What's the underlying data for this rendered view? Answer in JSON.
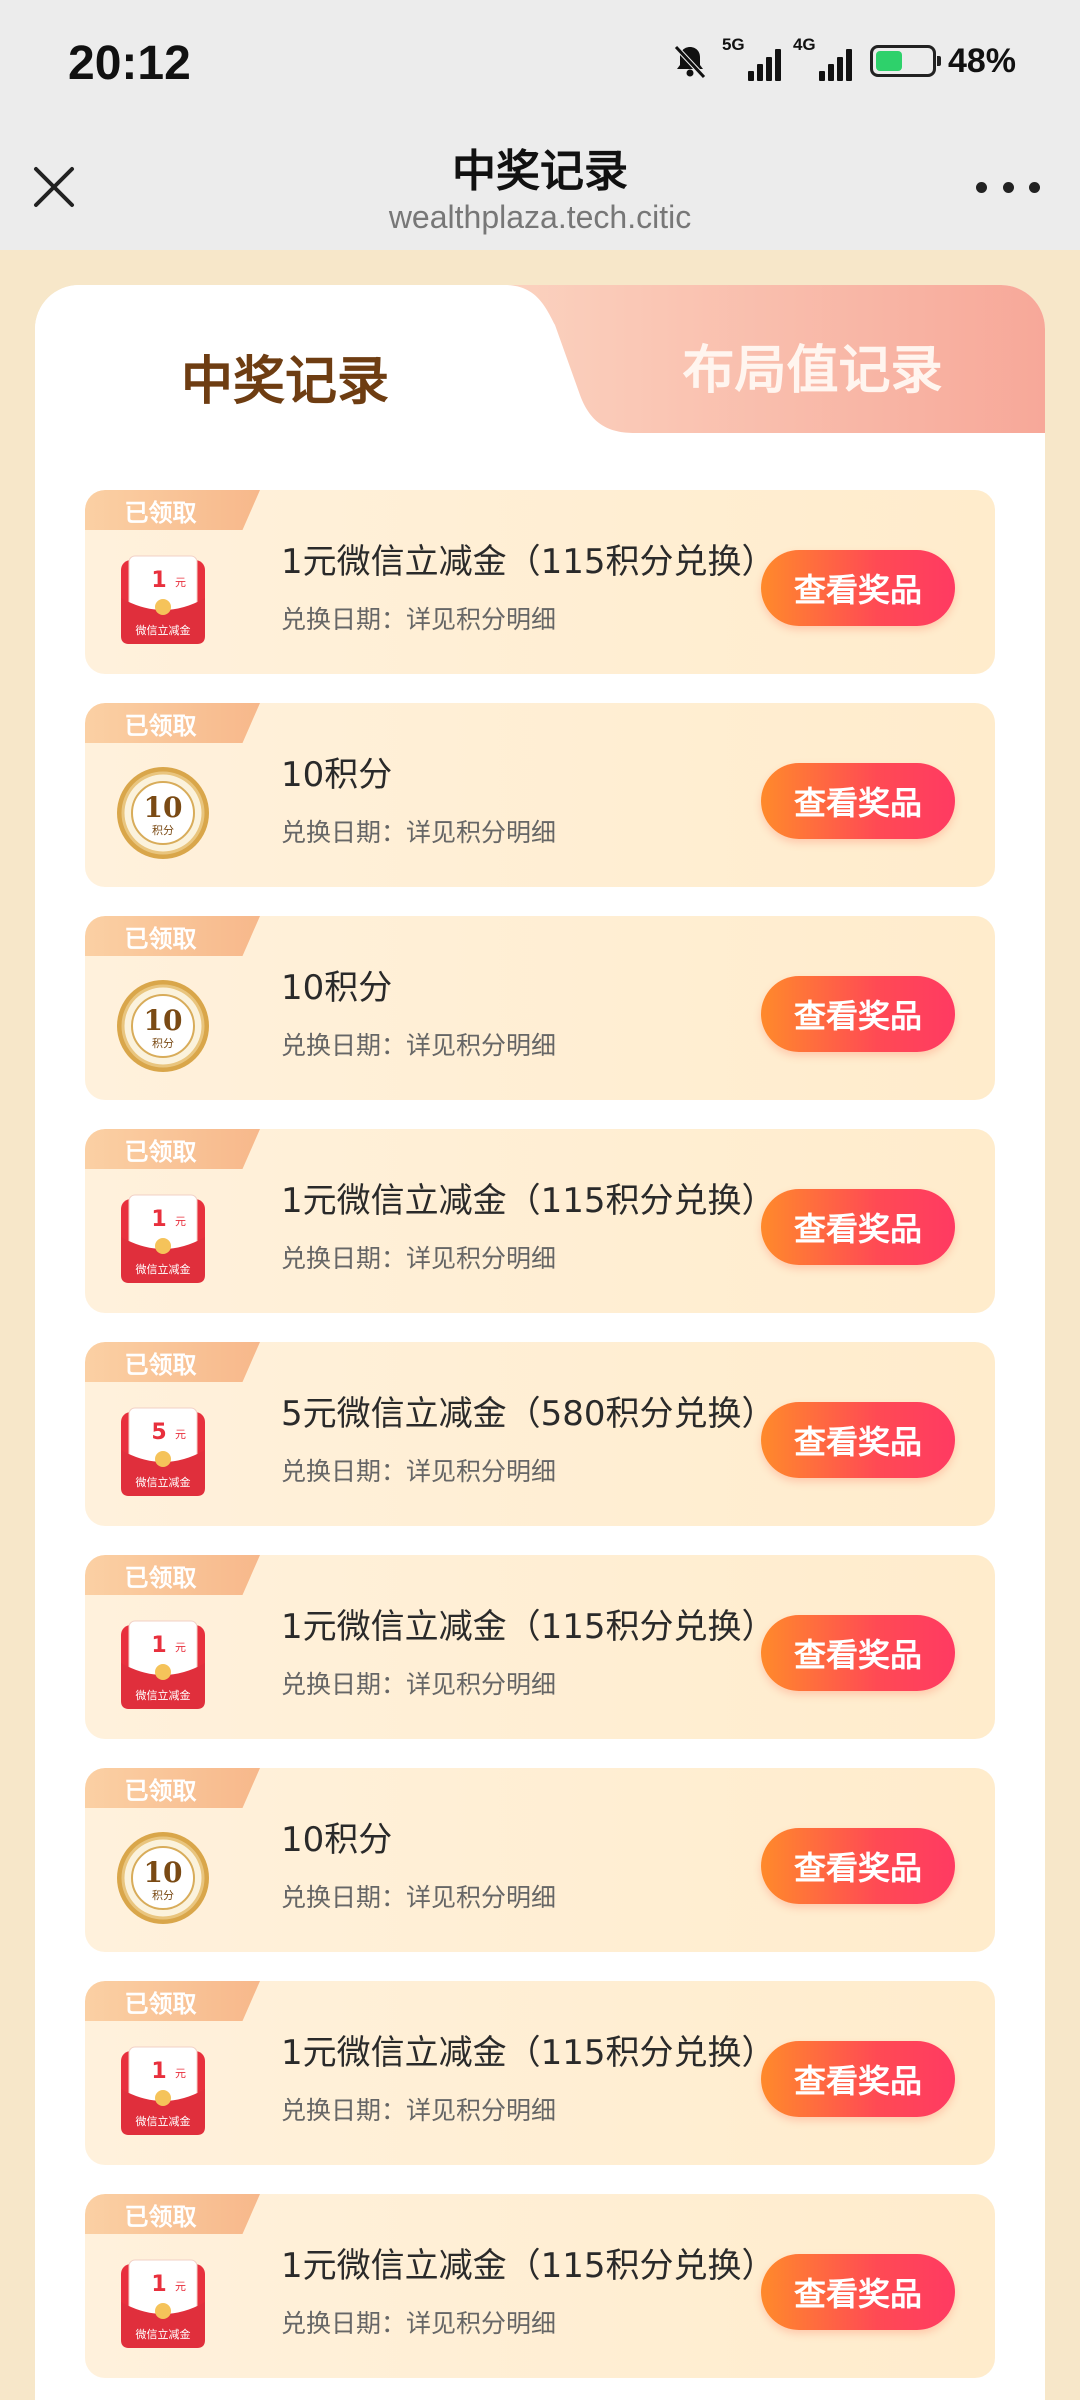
{
  "status_bar": {
    "time": "20:12",
    "network_1": "5G",
    "network_2": "4G",
    "battery_percent": "48%",
    "battery_level": 0.48,
    "icons": [
      "bell-muted-icon",
      "signal-icon",
      "signal-icon",
      "battery-icon"
    ]
  },
  "nav": {
    "title": "中奖记录",
    "url": "wealthplaza.tech.citic",
    "close_icon": "close-icon",
    "more_icon": "more-icon"
  },
  "tabs": [
    {
      "label": "中奖记录",
      "active": true
    },
    {
      "label": "布局值记录",
      "active": false
    }
  ],
  "records": [
    {
      "badge": "已领取",
      "type": "red-packet",
      "icon_amount": "1",
      "icon_unit": "元",
      "icon_caption": "微信立减金",
      "title": "1元微信立减金（115积分兑换）",
      "subtitle": "兑换日期：详见积分明细",
      "button": "查看奖品"
    },
    {
      "badge": "已领取",
      "type": "points-coin",
      "icon_amount": "10",
      "icon_unit": "",
      "icon_caption": "积分",
      "title": "10积分",
      "subtitle": "兑换日期：详见积分明细",
      "button": "查看奖品"
    },
    {
      "badge": "已领取",
      "type": "points-coin",
      "icon_amount": "10",
      "icon_unit": "",
      "icon_caption": "积分",
      "title": "10积分",
      "subtitle": "兑换日期：详见积分明细",
      "button": "查看奖品"
    },
    {
      "badge": "已领取",
      "type": "red-packet",
      "icon_amount": "1",
      "icon_unit": "元",
      "icon_caption": "微信立减金",
      "title": "1元微信立减金（115积分兑换）",
      "subtitle": "兑换日期：详见积分明细",
      "button": "查看奖品"
    },
    {
      "badge": "已领取",
      "type": "red-packet",
      "icon_amount": "5",
      "icon_unit": "元",
      "icon_caption": "微信立减金",
      "title": "5元微信立减金（580积分兑换）",
      "subtitle": "兑换日期：详见积分明细",
      "button": "查看奖品"
    },
    {
      "badge": "已领取",
      "type": "red-packet",
      "icon_amount": "1",
      "icon_unit": "元",
      "icon_caption": "微信立减金",
      "title": "1元微信立减金（115积分兑换）",
      "subtitle": "兑换日期：详见积分明细",
      "button": "查看奖品"
    },
    {
      "badge": "已领取",
      "type": "points-coin",
      "icon_amount": "10",
      "icon_unit": "",
      "icon_caption": "积分",
      "title": "10积分",
      "subtitle": "兑换日期：详见积分明细",
      "button": "查看奖品"
    },
    {
      "badge": "已领取",
      "type": "red-packet",
      "icon_amount": "1",
      "icon_unit": "元",
      "icon_caption": "微信立减金",
      "title": "1元微信立减金（115积分兑换）",
      "subtitle": "兑换日期：详见积分明细",
      "button": "查看奖品"
    },
    {
      "badge": "已领取",
      "type": "red-packet",
      "icon_amount": "1",
      "icon_unit": "元",
      "icon_caption": "微信立减金",
      "title": "1元微信立减金（115积分兑换）",
      "subtitle": "兑换日期：详见积分明细",
      "button": "查看奖品"
    }
  ],
  "colors": {
    "page_bg": "#f7e7c9",
    "active_tab_text": "#6e3d12",
    "button_gradient_start": "#ff8a2b",
    "button_gradient_end": "#ff3a62",
    "badge": "#f7b88b"
  }
}
